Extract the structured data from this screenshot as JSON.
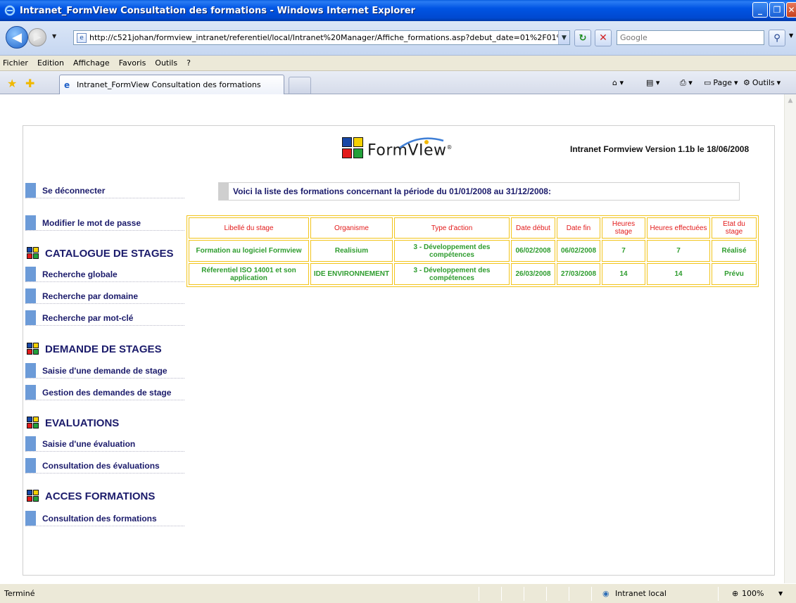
{
  "window": {
    "title": "Intranet_FormView Consultation des formations - Windows Internet Explorer"
  },
  "address": {
    "url": "http://c521johan/formview_intranet/referentiel/local/Intranet%20Manager/Affiche_formations.asp?debut_date=01%2F01%",
    "search_placeholder": "Google"
  },
  "menu": [
    "Fichier",
    "Edition",
    "Affichage",
    "Favoris",
    "Outils",
    "?"
  ],
  "tabs": {
    "active_label": "Intranet_FormView Consultation des formations",
    "commands": {
      "page": "Page",
      "tools": "Outils"
    }
  },
  "brand": {
    "logo_text": "FormVIew",
    "logo_mark": "®",
    "version": "Intranet Formview Version 1.1b le 18/06/2008"
  },
  "banner": "Voici la liste des formations concernant la période du 01/01/2008 au 31/12/2008:",
  "sidebar": {
    "top_links": [
      "Se déconnecter",
      "Modifier le mot de passe"
    ],
    "sections": [
      {
        "title": "CATALOGUE DE STAGES",
        "links": [
          "Recherche globale",
          "Recherche par domaine",
          "Recherche par mot-clé"
        ]
      },
      {
        "title": "DEMANDE DE STAGES",
        "links": [
          "Saisie d'une demande de stage",
          "Gestion des demandes de stage"
        ]
      },
      {
        "title": "EVALUATIONS",
        "links": [
          "Saisie d'une évaluation",
          "Consultation des évaluations"
        ]
      },
      {
        "title": "ACCES FORMATIONS",
        "links": [
          "Consultation des formations"
        ]
      }
    ]
  },
  "table": {
    "headers": [
      "Libellé du stage",
      "Organisme",
      "Type d'action",
      "Date début",
      "Date fin",
      "Heures stage",
      "Heures effectuées",
      "Etat du stage"
    ],
    "rows": [
      [
        "Formation au logiciel Formview",
        "Realisium",
        "3 - Développement des compétences",
        "06/02/2008",
        "06/02/2008",
        "7",
        "7",
        "Réalisé"
      ],
      [
        "Réferentiel ISO 14001 et son application",
        "IDE ENVIRONNEMENT",
        "3 - Développement des compétences",
        "26/03/2008",
        "27/03/2008",
        "14",
        "14",
        "Prévu"
      ]
    ]
  },
  "status": {
    "left": "Terminé",
    "zone": "Intranet local",
    "zoom": "100%"
  },
  "colors": {
    "titlebar": "#0054e3",
    "nav_text": "#1b1b6b",
    "nav_bar": "#6c9bd8",
    "table_border": "#f2c41a",
    "table_header": "#e21a1a",
    "table_cell": "#2e9c2e"
  }
}
